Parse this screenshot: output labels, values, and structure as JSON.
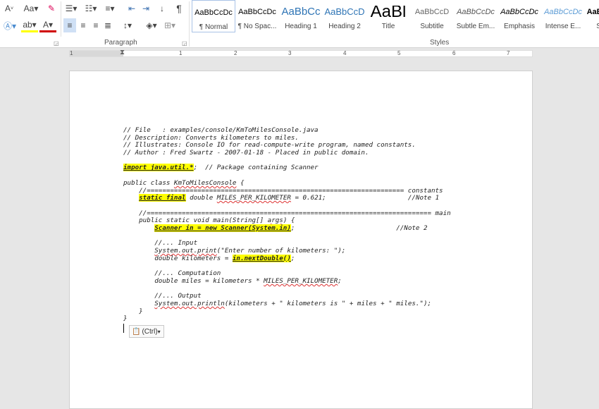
{
  "ribbon": {
    "paragraph_label": "Paragraph",
    "styles_label": "Styles",
    "font_case_label": "Aa",
    "accent_colors": {
      "highlight": "#ffff00",
      "font_color": "#d00000",
      "selected_align": "#cfe0f5"
    },
    "styles": [
      {
        "preview": "AaBbCcDc",
        "name": "¶ Normal",
        "selected": true
      },
      {
        "preview": "AaBbCcDc",
        "name": "¶ No Spac..."
      },
      {
        "preview": "AaBbCc",
        "name": "Heading 1",
        "color": "#2e74b5",
        "size": 15
      },
      {
        "preview": "AaBbCcD",
        "name": "Heading 2",
        "color": "#2e74b5",
        "size": 13
      },
      {
        "preview": "AaBl",
        "name": "Title",
        "size": 24
      },
      {
        "preview": "AaBbCcD",
        "name": "Subtitle",
        "color": "#666"
      },
      {
        "preview": "AaBbCcDc",
        "name": "Subtle Em...",
        "italic": true,
        "color": "#555"
      },
      {
        "preview": "AaBbCcDc",
        "name": "Emphasis",
        "italic": true
      },
      {
        "preview": "AaBbCcDc",
        "name": "Intense E...",
        "italic": true,
        "color": "#5b9bd5"
      },
      {
        "preview": "AaBbCcDc",
        "name": "Strong",
        "bold": true
      }
    ]
  },
  "ruler": {
    "numbers": [
      "1",
      "1",
      "2",
      "3",
      "4",
      "5",
      "6",
      "7"
    ]
  },
  "code_lines": [
    [
      {
        "t": "// File   : examples/console/KmToMilesConsole.java"
      }
    ],
    [
      {
        "t": "// Description: Converts kilometers to miles."
      }
    ],
    [
      {
        "t": "// Illustrates: Console IO for read-compute-write program, named constants."
      }
    ],
    [
      {
        "t": "// Author : Fred Swartz - 2007-01-18 - Placed in public domain."
      }
    ],
    [],
    [
      {
        "t": "import java.util.*",
        "c": "hl"
      },
      {
        "t": ";  // Package containing Scanner"
      }
    ],
    [],
    [
      {
        "t": "public class "
      },
      {
        "t": "KmToMilesConsole",
        "c": "sq"
      },
      {
        "t": " {"
      }
    ],
    [
      {
        "t": "    //================================================================== constants"
      }
    ],
    [
      {
        "t": "    "
      },
      {
        "t": "static final",
        "c": "hl"
      },
      {
        "t": " double "
      },
      {
        "t": "MILES_PER_KILOMETER",
        "c": "sq"
      },
      {
        "t": " = 0.621;                     //Note 1"
      }
    ],
    [],
    [
      {
        "t": "    //========================================================================= main"
      }
    ],
    [
      {
        "t": "    public static void main(String[] "
      },
      {
        "t": "args",
        "c": "sq"
      },
      {
        "t": ") {"
      }
    ],
    [
      {
        "t": "        "
      },
      {
        "t": "Scanner in = new Scanner(System.in)",
        "c": "hl"
      },
      {
        "t": ";                          //Note 2"
      }
    ],
    [],
    [
      {
        "t": "        //... Input"
      }
    ],
    [
      {
        "t": "        "
      },
      {
        "t": "System.out.print",
        "c": "sq"
      },
      {
        "t": "(\"Enter number of kilometers: \");"
      }
    ],
    [
      {
        "t": "        double kilometers = "
      },
      {
        "t": "in.nextDouble()",
        "c": "hl"
      },
      {
        "t": ";"
      }
    ],
    [],
    [
      {
        "t": "        //... Computation"
      }
    ],
    [
      {
        "t": "        double miles = kilometers * "
      },
      {
        "t": "MILES_PER_KILOMETER",
        "c": "sq"
      },
      {
        "t": ";"
      }
    ],
    [],
    [
      {
        "t": "        //... Output"
      }
    ],
    [
      {
        "t": "        "
      },
      {
        "t": "System.out.println",
        "c": "sq"
      },
      {
        "t": "(kilometers + \" kilometers is \" + miles + \" miles.\");"
      }
    ],
    [
      {
        "t": "    }"
      }
    ],
    [
      {
        "t": "}"
      }
    ]
  ],
  "paste_options": {
    "label": "(Ctrl)",
    "caret": "▾"
  }
}
